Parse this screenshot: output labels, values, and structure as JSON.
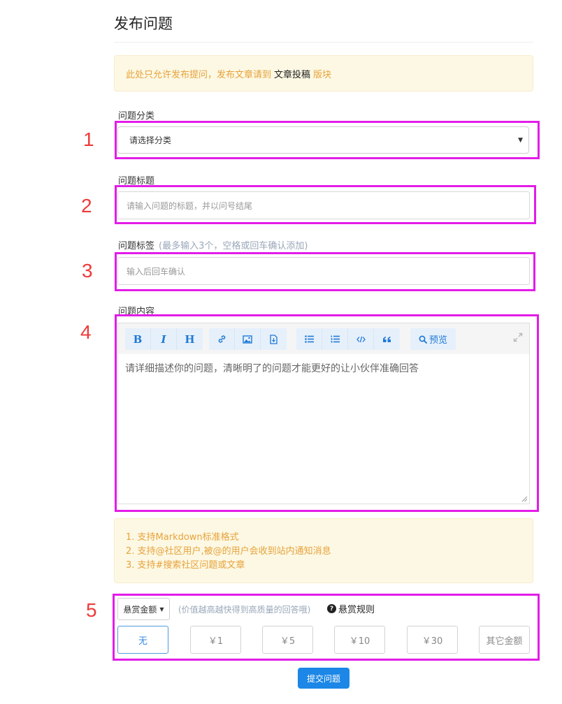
{
  "page": {
    "title": "发布问题"
  },
  "notice": {
    "prefix": "此处只允许发布提问，发布文章请到",
    "link": "文章投稿",
    "suffix": "版块"
  },
  "category": {
    "label": "问题分类",
    "value": "请选择分类"
  },
  "title_field": {
    "label": "问题标题",
    "placeholder": "请输入问题的标题，并以问号结尾"
  },
  "tags": {
    "label": "问题标签",
    "hint": "(最多输入3个，空格或回车确认添加)",
    "placeholder": "输入后回车确认"
  },
  "content": {
    "label": "问题内容",
    "placeholder": "请详细描述你的问题，清晰明了的问题才能更好的让小伙伴准确回答",
    "toolbar": {
      "bold": "B",
      "italic": "I",
      "heading": "H",
      "preview": "预览"
    }
  },
  "tips": {
    "items": [
      "1. 支持Markdown标准格式",
      "2. 支持@社区用户,被@的用户会收到站内通知消息",
      "3. 支持#搜索社区问题或文章"
    ]
  },
  "reward": {
    "dropdown_label": "悬赏金额",
    "hint": "(价值越高越快得到高质量的回答哦)",
    "rules_label": "悬赏规则",
    "options": [
      "无",
      "￥1",
      "￥5",
      "￥10",
      "￥30",
      "其它金额"
    ]
  },
  "submit": {
    "label": "提交问题"
  },
  "annotations": [
    "1",
    "2",
    "3",
    "4",
    "5"
  ],
  "colors": {
    "accent": "#1c87e6",
    "annotation_box": "#e31ce8",
    "annotation_number": "#ef3a3a",
    "notice_text": "#e8a23b"
  }
}
